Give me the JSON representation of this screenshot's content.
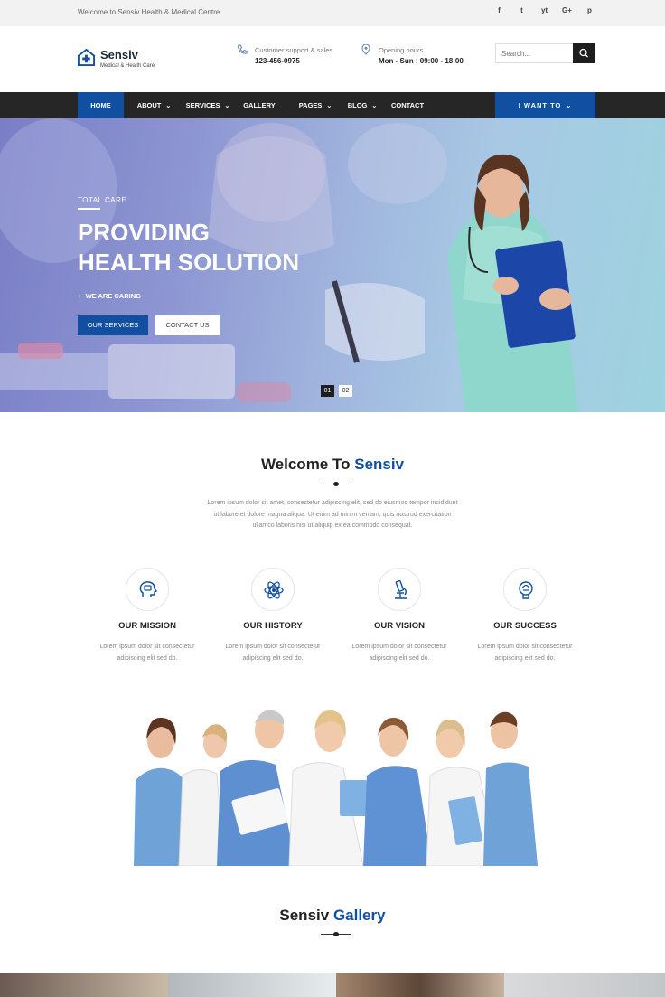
{
  "topbar": {
    "welcome": "Welcome to Sensiv Health & Medical Centre",
    "socials": [
      "f",
      "t",
      "yt",
      "G+",
      "p"
    ],
    "social_icons": [
      "facebook-icon",
      "twitter-icon",
      "youtube-icon",
      "google-plus-icon",
      "pinterest-icon"
    ]
  },
  "header": {
    "brand": "Sensiv",
    "tagline": "Medical & Health Care",
    "support_label": "Customer support & sales",
    "support_value": "123-456-0975",
    "hours_label": "Opening hours",
    "hours_value": "Mon - Sun : 09:00 - 18:00",
    "search_placeholder": "Search..."
  },
  "nav": {
    "items": [
      {
        "label": "HOME",
        "active": true
      },
      {
        "label": "ABOUT",
        "dropdown": true
      },
      {
        "label": "SERVICES",
        "dropdown": true
      },
      {
        "label": "GALLERY"
      },
      {
        "label": "PAGES",
        "dropdown": true
      },
      {
        "label": "BLOG",
        "dropdown": true
      },
      {
        "label": "CONTACT"
      }
    ],
    "cta": "I WANT TO"
  },
  "hero": {
    "overline": "TOTAL CARE",
    "title_line1": "PROVIDING",
    "title_line2": "HEALTH SOLUTION",
    "subtitle": "WE ARE CARING",
    "button_primary": "OUR SERVICES",
    "button_secondary": "CONTACT US",
    "slides": [
      "01",
      "02"
    ]
  },
  "welcome": {
    "title_plain": "Welcome To",
    "title_accent": "Sensiv",
    "text_line1": "Lorem ipsum dolor sit amet, consectetur adipiscing elit, sed do eiusmod tempor incididunt",
    "text_line2": "ut labore et dolore magna aliqua. Ut enim ad minim veniam, quis nostrud exercitation",
    "text_line3": "ullamco laboris nisi ut aliquip ex ea commodo consequat."
  },
  "features": [
    {
      "name": "OUR MISSION",
      "icon": "head-idea-icon",
      "desc1": "Lorem ipsum dolor sit consectetur",
      "desc2": "adipiscing elit sed do."
    },
    {
      "name": "OUR HISTORY",
      "icon": "atom-icon",
      "desc1": "Lorem ipsum dolor sit consectetur",
      "desc2": "adipiscing elit sed do."
    },
    {
      "name": "OUR VISION",
      "icon": "microscope-icon",
      "desc1": "Lorem ipsum dolor sit consectetur",
      "desc2": "adipiscing elit sed do."
    },
    {
      "name": "OUR SUCCESS",
      "icon": "trophy-icon",
      "desc1": "Lorem ipsum dolor sit consectetur",
      "desc2": "adipiscing elit sed do."
    }
  ],
  "gallery": {
    "title_plain": "Sensiv",
    "title_accent": "Gallery"
  },
  "colors": {
    "accent": "#1150a0",
    "nav_bg": "#262626",
    "topbar_bg": "#f2f2f2"
  }
}
